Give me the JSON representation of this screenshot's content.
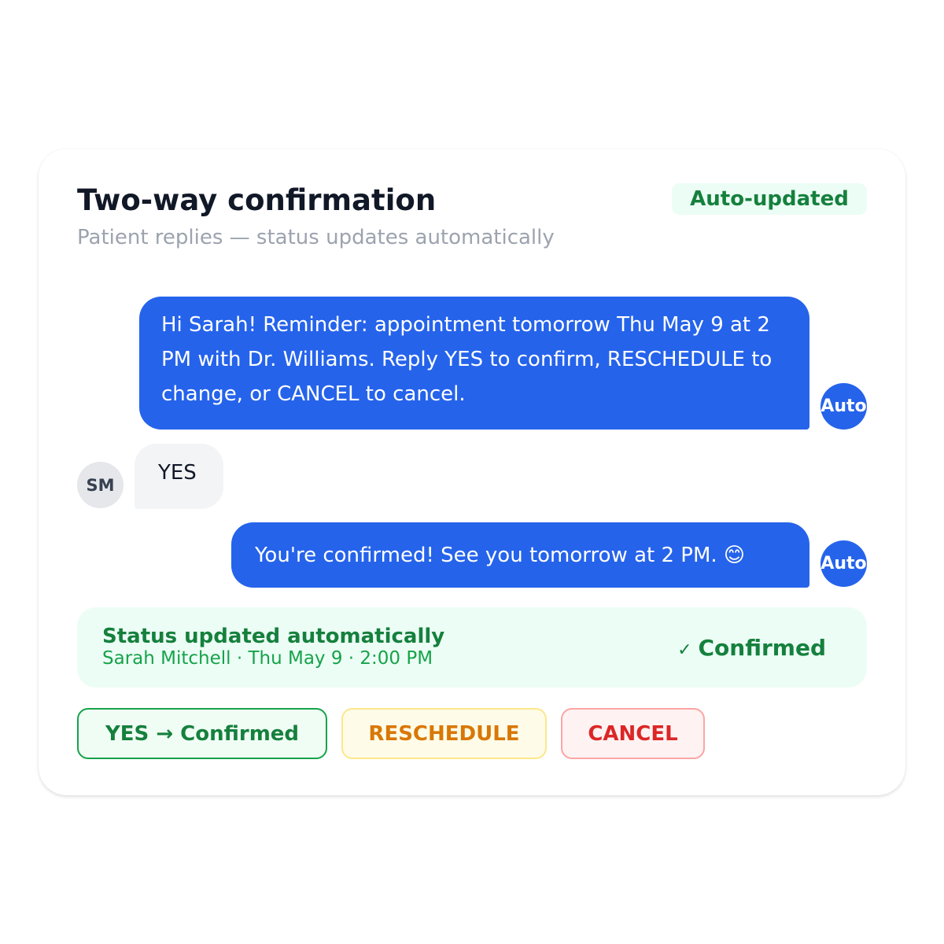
{
  "header": {
    "title": "Two-way confirmation",
    "subtitle": "Patient replies — status updates automatically",
    "badge": "Auto-updated"
  },
  "messages": [
    {
      "direction": "outgoing",
      "sender_avatar": "Auto",
      "text": "Hi Sarah! Reminder: appointment tomorrow Thu May 9 at 2 PM with Dr. Williams. Reply YES to confirm, RESCHEDULE to change, or CANCEL to cancel."
    },
    {
      "direction": "incoming",
      "sender_avatar": "SM",
      "text": "YES"
    },
    {
      "direction": "outgoing",
      "sender_avatar": "Auto",
      "text": "You're confirmed! See you tomorrow at 2 PM. 😊"
    }
  ],
  "status": {
    "title": "Status updated automatically",
    "detail": "Sarah Mitchell · Thu May 9 · 2:00 PM",
    "check_icon": "✓",
    "state": "Confirmed"
  },
  "actions": {
    "yes_label": "YES → Confirmed",
    "reschedule_label": "RESCHEDULE",
    "cancel_label": "CANCEL"
  },
  "colors": {
    "accent_blue": "#2563eb",
    "success_green": "#15803d",
    "warning_amber": "#d97706",
    "danger_red": "#dc2626"
  }
}
